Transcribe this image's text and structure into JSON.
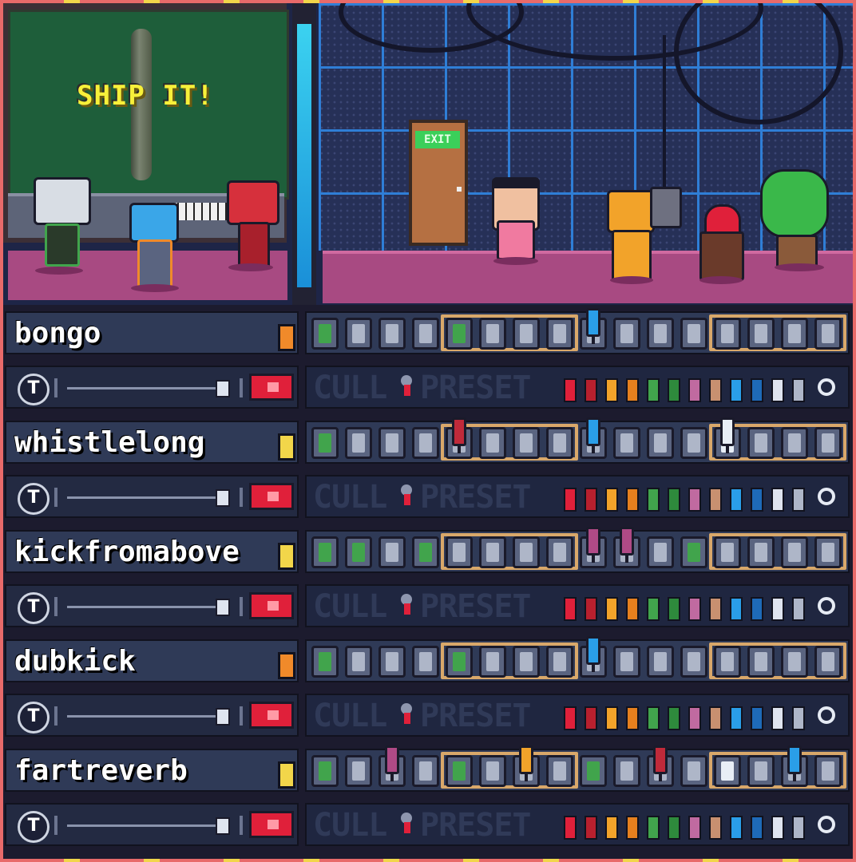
{
  "stage": {
    "board_text": "SHIP IT!",
    "exit_sign": "EXIT"
  },
  "tracks": [
    {
      "name": "bongo",
      "indicator_color": "#f08a2a",
      "steps": [
        "on",
        "off",
        "off",
        "off",
        "on",
        "off",
        "off",
        "off",
        "blue",
        "off",
        "off",
        "off",
        "off",
        "off",
        "off",
        "off"
      ],
      "markers": [
        {
          "step": 8,
          "color": "#2a9ee8"
        }
      ]
    },
    {
      "name": "whistlelong",
      "indicator_color": "#f2d64a",
      "steps": [
        "on",
        "off",
        "off",
        "off",
        "red",
        "off",
        "off",
        "off",
        "blue",
        "off",
        "off",
        "off",
        "hi",
        "off",
        "off",
        "off"
      ],
      "markers": [
        {
          "step": 4,
          "color": "#c02a3a"
        },
        {
          "step": 8,
          "color": "#2a9ee8"
        },
        {
          "step": 12,
          "color": "#e8eef6"
        }
      ]
    },
    {
      "name": "kickfromabove",
      "indicator_color": "#f2d64a",
      "steps": [
        "on",
        "on",
        "off",
        "on",
        "off",
        "off",
        "off",
        "off",
        "pink",
        "pink",
        "off",
        "on",
        "off",
        "off",
        "off",
        "off"
      ],
      "markers": [
        {
          "step": 8,
          "color": "#b04a86"
        },
        {
          "step": 9,
          "color": "#b04a86"
        }
      ]
    },
    {
      "name": "dubkick",
      "indicator_color": "#f08a2a",
      "steps": [
        "on",
        "off",
        "off",
        "off",
        "on",
        "off",
        "off",
        "off",
        "blue",
        "off",
        "off",
        "off",
        "off",
        "off",
        "off",
        "off"
      ],
      "markers": [
        {
          "step": 8,
          "color": "#2a9ee8"
        }
      ]
    },
    {
      "name": "fartreverb",
      "indicator_color": "#f2d64a",
      "steps": [
        "on",
        "off",
        "pink",
        "off",
        "on",
        "off",
        "yellow",
        "off",
        "on",
        "off",
        "red",
        "off",
        "hi",
        "off",
        "blue",
        "off"
      ],
      "markers": [
        {
          "step": 2,
          "color": "#b04a86"
        },
        {
          "step": 6,
          "color": "#f2a32a"
        },
        {
          "step": 10,
          "color": "#c02a3a"
        },
        {
          "step": 14,
          "color": "#2a9ee8"
        }
      ]
    }
  ],
  "controls": {
    "icon": "T",
    "cull_label": "CULL",
    "preset_label": "PRESET",
    "slider_level": 0.98,
    "mute_color": "#e0203a",
    "swatches": [
      "#e0203a",
      "#b8202e",
      "#f2a32a",
      "#e6801e",
      "#41a44c",
      "#2e8a3c",
      "#c06aa0",
      "#c89070",
      "#2a9ee8",
      "#1e6ab8",
      "#dfe4ef",
      "#aeb6c8"
    ]
  },
  "colors": {
    "frame": "#e86a6a",
    "highlight": "#d9a86a",
    "step_on": "#41a44c"
  }
}
